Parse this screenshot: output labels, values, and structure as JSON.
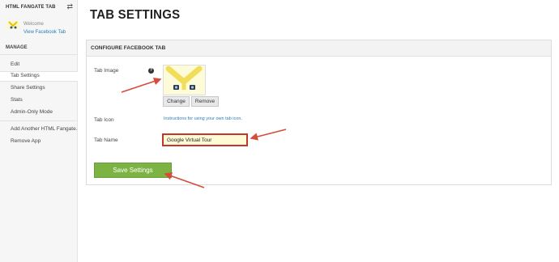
{
  "sidebar": {
    "header": "HTML FANGATE TAB",
    "welcome": "Welcome",
    "view_link": "View Facebook Tab",
    "section": "MANAGE",
    "items": [
      {
        "label": "Edit"
      },
      {
        "label": "Tab Settings"
      },
      {
        "label": "Share Settings"
      },
      {
        "label": "Stats"
      },
      {
        "label": "Admin-Only Mode"
      },
      {
        "label": "Add Another HTML Fangate..."
      },
      {
        "label": "Remove App"
      }
    ]
  },
  "main": {
    "title": "TAB SETTINGS",
    "panel_title": "CONFIGURE FACEBOOK TAB",
    "tab_image_label": "Tab Image",
    "help_glyph": "?",
    "change_label": "Change",
    "remove_label": "Remove",
    "tab_icon_label": "Tab Icon",
    "tab_icon_link": "Instructions for using your own tab icon.",
    "tab_name_label": "Tab Name",
    "tab_name_value": "Google Virtual Tour",
    "save_label": "Save Settings"
  },
  "colors": {
    "accent_green": "#7cb342",
    "link_blue": "#2a7fb8",
    "annotation_red": "#c0392b"
  }
}
